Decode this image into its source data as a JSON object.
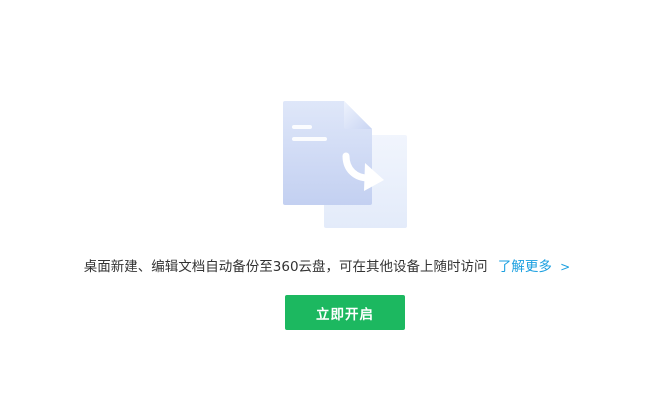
{
  "prompt": {
    "description": "桌面新建、编辑文档自动备份至360云盘，可在其他设备上随时访问",
    "learn_more_label": "了解更多",
    "learn_more_chevron": ">"
  },
  "action": {
    "enable_label": "立即开启"
  },
  "colors": {
    "accent_green": "#1cb860",
    "link_blue": "#1a9fe0",
    "text": "#333333"
  },
  "icons": {
    "illustration": "document-backup-icon"
  }
}
